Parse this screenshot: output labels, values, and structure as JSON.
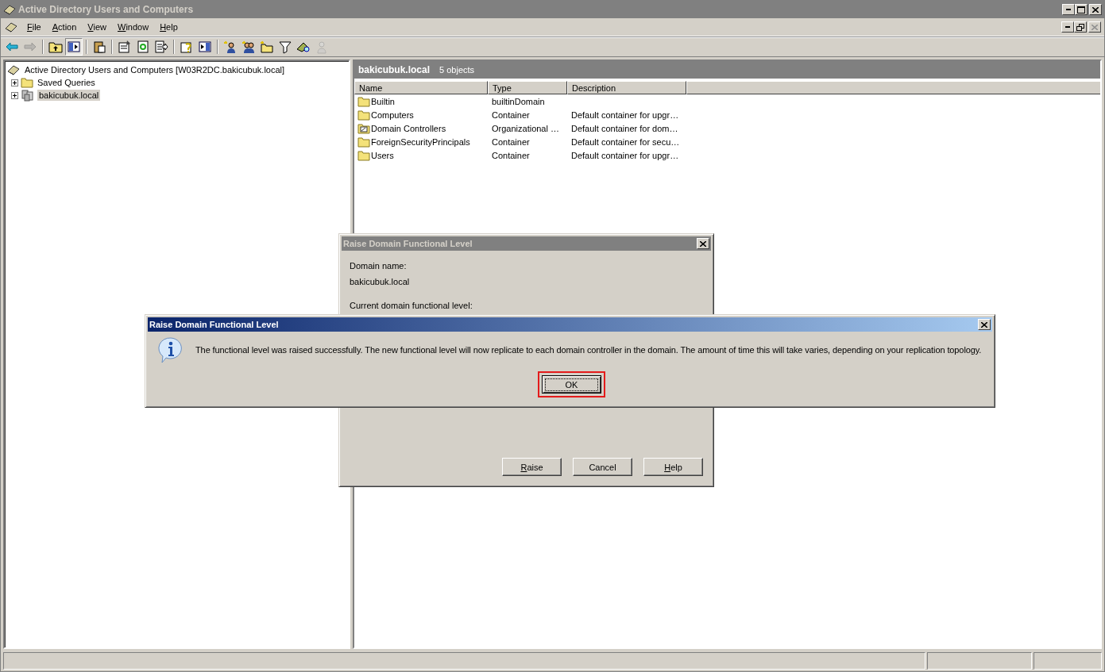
{
  "window": {
    "title": "Active Directory Users and Computers",
    "active": false
  },
  "menu": [
    {
      "label": "File",
      "mnemonic": true
    },
    {
      "label": "Action",
      "mnemonic": true
    },
    {
      "label": "View",
      "mnemonic": true
    },
    {
      "label": "Window",
      "mnemonic": true
    },
    {
      "label": "Help",
      "mnemonic": true
    }
  ],
  "toolbar": [
    {
      "kind": "back",
      "disabled": false,
      "pressed": false
    },
    {
      "kind": "forward",
      "disabled": true,
      "pressed": false
    },
    {
      "kind": "separator"
    },
    {
      "kind": "up",
      "disabled": false,
      "pressed": false
    },
    {
      "kind": "tree",
      "disabled": false,
      "pressed": true
    },
    {
      "kind": "separator"
    },
    {
      "kind": "clipboard",
      "disabled": false,
      "pressed": false
    },
    {
      "kind": "separator"
    },
    {
      "kind": "properties",
      "disabled": false,
      "pressed": false
    },
    {
      "kind": "refresh",
      "disabled": false,
      "pressed": false
    },
    {
      "kind": "export",
      "disabled": false,
      "pressed": false
    },
    {
      "kind": "separator"
    },
    {
      "kind": "help",
      "disabled": false,
      "pressed": false
    },
    {
      "kind": "pane",
      "disabled": false,
      "pressed": false
    },
    {
      "kind": "separator"
    },
    {
      "kind": "new-user",
      "disabled": false,
      "pressed": false
    },
    {
      "kind": "new-group",
      "disabled": false,
      "pressed": false
    },
    {
      "kind": "new-ou",
      "disabled": false,
      "pressed": false
    },
    {
      "kind": "filter",
      "disabled": false,
      "pressed": false
    },
    {
      "kind": "find",
      "disabled": false,
      "pressed": false
    },
    {
      "kind": "add-group",
      "disabled": true,
      "pressed": false
    }
  ],
  "tree": {
    "label": "Active Directory Users and Computers [W03R2DC.bakicubuk.local]",
    "children": [
      {
        "label": "Saved Queries",
        "kind": "folder",
        "expanded": false,
        "selected": false
      },
      {
        "label": "bakicubuk.local",
        "kind": "domain",
        "expanded": false,
        "selected": true
      }
    ]
  },
  "details": {
    "title": "bakicubuk.local",
    "count": "5 objects",
    "columns": [
      "Name",
      "Type",
      "Description"
    ],
    "rows": [
      {
        "kind": "folder",
        "cells": [
          "Builtin",
          "builtinDomain",
          ""
        ]
      },
      {
        "kind": "folder",
        "cells": [
          "Computers",
          "Container",
          "Default container for upgr…"
        ]
      },
      {
        "kind": "ou",
        "cells": [
          "Domain Controllers",
          "Organizational …",
          "Default container for dom…"
        ]
      },
      {
        "kind": "folder",
        "cells": [
          "ForeignSecurityPrincipals",
          "Container",
          "Default container for secu…"
        ]
      },
      {
        "kind": "folder",
        "cells": [
          "Users",
          "Container",
          "Default container for upgr…"
        ]
      }
    ]
  },
  "back_dialog": {
    "title": "Raise Domain Functional Level",
    "active": false,
    "fields": [
      "Domain name:",
      "bakicubuk.local",
      "Current domain functional level:"
    ],
    "buttons": [
      {
        "label": "Raise",
        "mnemonic": true
      },
      {
        "label": "Cancel",
        "mnemonic": false
      },
      {
        "label": "Help",
        "mnemonic": true
      }
    ]
  },
  "message_box": {
    "title": "Raise Domain Functional Level",
    "active": true,
    "message": "The functional level was raised successfully. The new functional level will now replicate to each domain controller in the domain. The amount of time this will take varies, depending on your replication topology.",
    "button": {
      "label": "OK",
      "focused": true,
      "highlighted": true
    }
  }
}
